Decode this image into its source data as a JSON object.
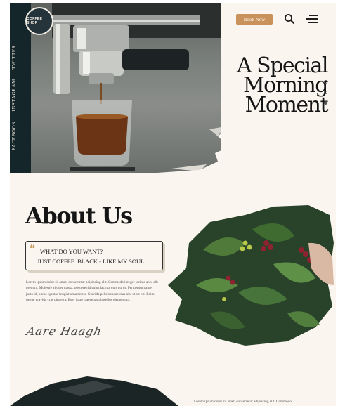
{
  "brand": {
    "logo_text": "COFFEE SHOP"
  },
  "header": {
    "book_label": "Book Now"
  },
  "hero": {
    "title_lines": [
      "A Special",
      "Morning",
      "Moment"
    ]
  },
  "social": [
    "FACEBOOK",
    "INSTAGRAM",
    "TWITTER"
  ],
  "about": {
    "title": "About Us",
    "quote_line1": "WHAT DO YOU WANT?",
    "quote_line2": "JUST COFFEE. BLACK - LIKE MY SOUL.",
    "body": "Lorem ipsum dolor sit amet, consectetur adipiscing elit. Commodo integer lacinia arcu elit pretium. Molestie aliquet massa, posuere ridiculus lacinia quis purus. Fermentum amet justo id, purus egestas feugiat urna turpis. Gravida pellentesque cras nisi ut sit est. Enim neque gravida cras pharetra. Eget justo maecenas phasellus elementum.",
    "signature": "Aare Haagh"
  },
  "bottom": {
    "text": "Lorem ipsum dolor sit amet, consectetur adipiscing elit. Commodo"
  },
  "colors": {
    "page_bg": "#faf6ef",
    "accent": "#c9925b",
    "dark": "#15262a"
  },
  "icons": [
    "search-icon",
    "menu-icon",
    "quote-icon"
  ]
}
